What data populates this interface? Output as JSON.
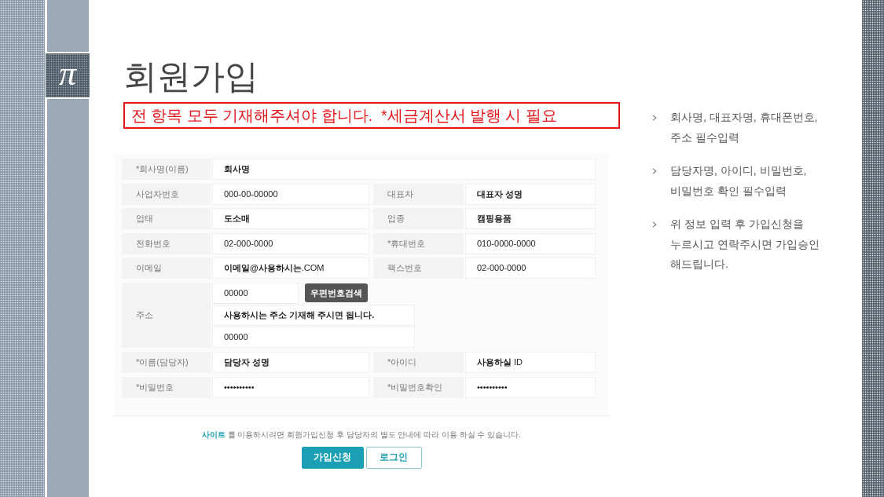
{
  "slide": {
    "logo_glyph": "π",
    "title": "회원가입",
    "notice": "전 항목 모두 기재해주셔야 합니다.  *세금계산서 발행 시 필요"
  },
  "form": {
    "rows": [
      {
        "kind": "single",
        "fields": [
          {
            "label": "*회사명(이름)",
            "value": "회사명",
            "bold": true
          }
        ]
      },
      {
        "kind": "pair",
        "fields": [
          {
            "label": "사업자번호",
            "value": "000-00-00000",
            "bold": false
          },
          {
            "label": "대표자",
            "value": "대표자 성명",
            "bold": true
          }
        ]
      },
      {
        "kind": "pair",
        "fields": [
          {
            "label": "업태",
            "value": "도소매",
            "bold": true
          },
          {
            "label": "업종",
            "value": "캠핑용품",
            "bold": true
          }
        ]
      },
      {
        "kind": "pair",
        "fields": [
          {
            "label": "전화번호",
            "value": "02-000-0000",
            "bold": false
          },
          {
            "label": "*휴대번호",
            "value": "010-0000-0000",
            "bold": false
          }
        ]
      },
      {
        "kind": "pair",
        "fields": [
          {
            "label": "이메일",
            "value": "**이메일@사용하시는**.COM",
            "bold": false
          },
          {
            "label": "팩스번호",
            "value": "02-000-0000",
            "bold": false
          }
        ]
      },
      {
        "kind": "address",
        "label": "주소",
        "lines": [
          {
            "value": "00000",
            "bold": false,
            "button": "우편번호검색"
          },
          {
            "value": "사용하시는 주소 기재해 주시면 됩니다.",
            "bold": true
          },
          {
            "value": "00000",
            "bold": false
          }
        ]
      },
      {
        "kind": "pair",
        "fields": [
          {
            "label": "*이름(담당자)",
            "value": "담당자 성명",
            "bold": true
          },
          {
            "label": "*아이디",
            "value": "**사용하실** ID",
            "bold": false
          }
        ]
      },
      {
        "kind": "pair",
        "fields": [
          {
            "label": "*비밀번호",
            "value": "••••••••••",
            "bold": false
          },
          {
            "label": "*비밀번호확인",
            "value": "••••••••••",
            "bold": false
          }
        ]
      }
    ]
  },
  "footer": {
    "note": "**사이트** 를 이용하시려면 회원가입신청 후 담당자의 별도 안내에 따라 이용 하실 수 있습니다.",
    "buttons": [
      {
        "label": "가입신청",
        "kind": "primary"
      },
      {
        "label": "로그인",
        "kind": "outline"
      }
    ]
  },
  "tips": [
    "회사명, 대표자명, 휴대폰번호, 주소 필수입력",
    "담당자명, 아이디, 비밀번호, 비밀번호 확인 필수입력",
    "위 정보 입력 후 가입신청을 누르시고 연락주시면 가입승인 해드립니다."
  ]
}
